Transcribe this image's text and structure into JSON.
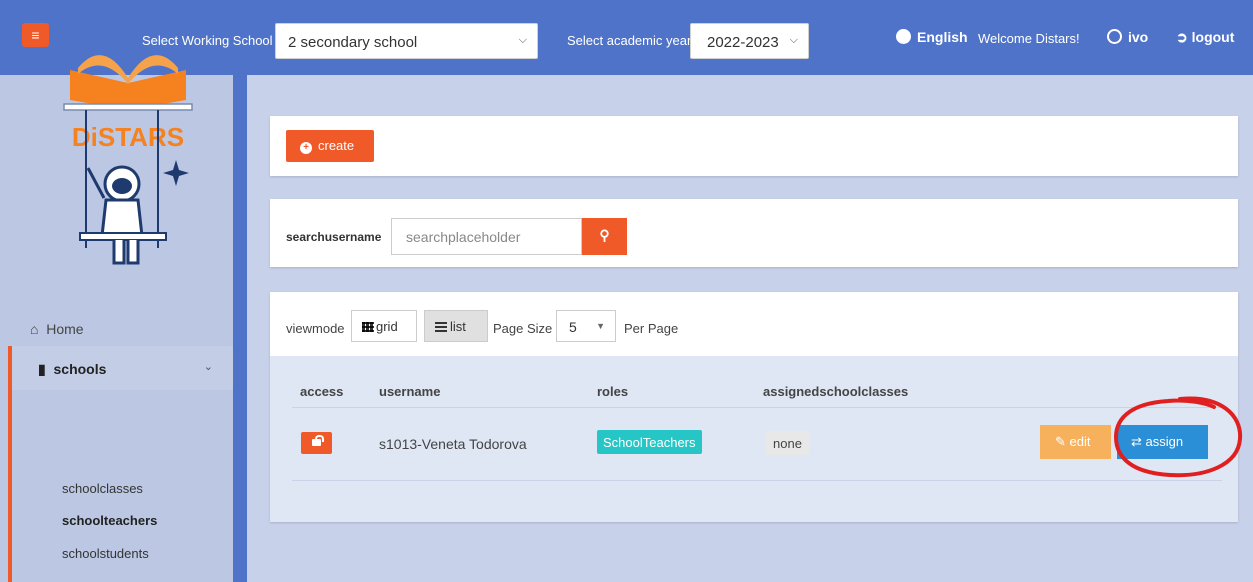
{
  "topbar": {
    "select_school_label": "Select Working School",
    "school_value": "2 secondary school",
    "select_year_label": "Select academic year",
    "year_value": "2022-2023",
    "language": "English",
    "welcome": "Welcome Distars!",
    "user": "ivo",
    "logout": "logout"
  },
  "sidebar": {
    "logo_text": "DiSTARS",
    "home": "Home",
    "schools": "schools",
    "sub_items": [
      "schoolclasses",
      "schoolteachers",
      "schoolstudents"
    ]
  },
  "toolbar": {
    "create": "create"
  },
  "search": {
    "label": "searchusername",
    "placeholder": "searchplaceholder"
  },
  "viewmode": {
    "label": "viewmode",
    "grid": "grid",
    "list": "list",
    "page_size_label": "Page Size",
    "page_size_value": "5",
    "per_page_label": "Per Page"
  },
  "table": {
    "headers": [
      "access",
      "username",
      "roles",
      "assignedschoolclasses"
    ],
    "rows": [
      {
        "username": "s1013-Veneta Todorova",
        "role": "SchoolTeachers",
        "assigned": "none",
        "edit": "edit",
        "assign": "assign"
      }
    ]
  },
  "colors": {
    "topbar": "#4f73c8",
    "accent": "#f05a28",
    "role_badge": "#26c6c6",
    "edit_button": "#f7b15c",
    "assign_button": "#2a8fd6",
    "annotation": "#e02020"
  }
}
